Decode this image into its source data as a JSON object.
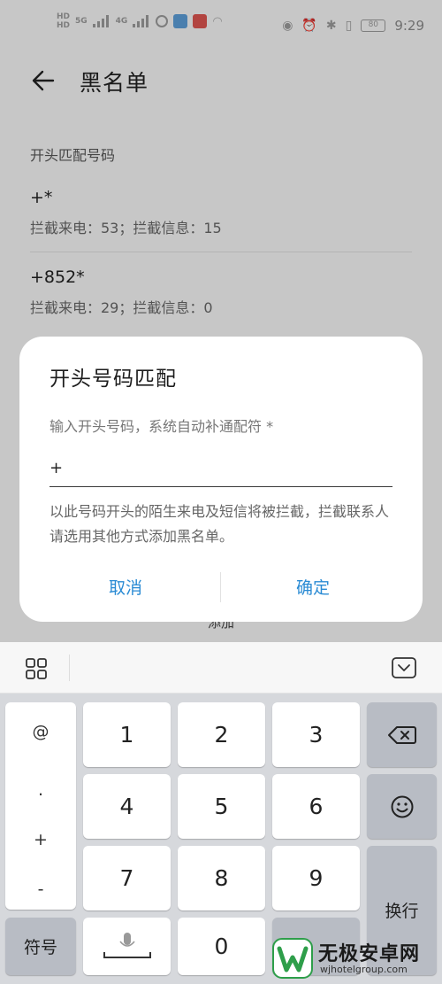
{
  "status_bar": {
    "sim1": "HD",
    "sim2": "HD",
    "net1": "5G",
    "net2": "4G",
    "battery": "80",
    "time": "9:29"
  },
  "app_bar": {
    "title": "黑名单"
  },
  "list": {
    "section_label": "开头匹配号码",
    "entries": [
      {
        "number": "+*",
        "stats": "拦截来电：53；拦截信息：15"
      },
      {
        "number": "+852*",
        "stats": "拦截来电：29；拦截信息：0"
      }
    ],
    "add_label": "添加"
  },
  "dialog": {
    "title": "开头号码匹配",
    "hint": "输入开头号码，系统自动补通配符 *",
    "input_value": "+",
    "note": "以此号码开头的陌生来电及短信将被拦截，拦截联系人请选用其他方式添加黑名单。",
    "cancel_label": "取消",
    "confirm_label": "确定",
    "accent_color": "#2a8bd4"
  },
  "keyboard": {
    "symbols": [
      "@",
      ".",
      "+",
      "-"
    ],
    "digits": [
      "1",
      "2",
      "3",
      "4",
      "5",
      "6",
      "7",
      "8",
      "9",
      "0"
    ],
    "symbol_key_label": "符号",
    "enter_label": "换行",
    "icons": [
      "grid-icon",
      "collapse-keyboard-icon",
      "backspace-icon",
      "emoji-icon",
      "microphone-icon"
    ]
  },
  "watermark": {
    "name": "无极安卓网",
    "url": "wjhotelgroup.com"
  }
}
